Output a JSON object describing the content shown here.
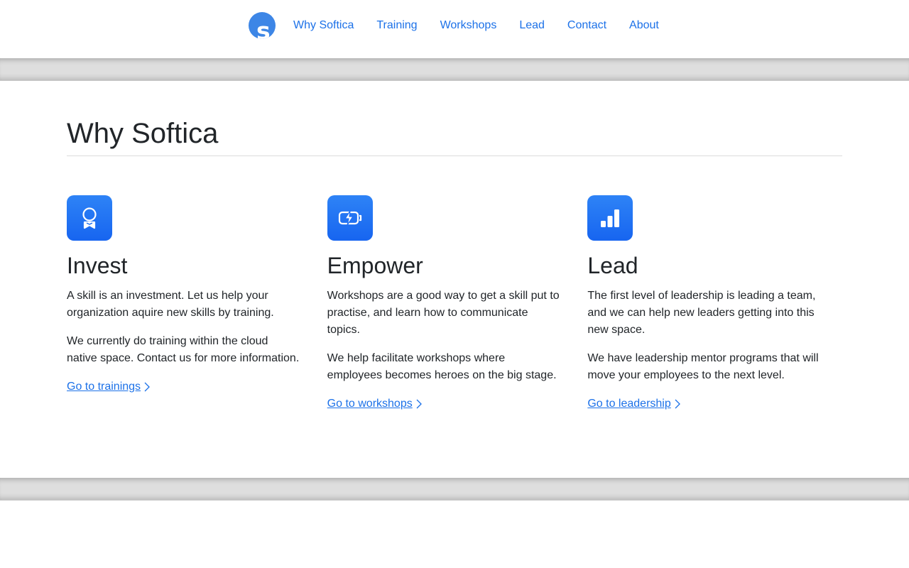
{
  "nav": {
    "logo_letter": "s",
    "links": [
      "Why Softica",
      "Training",
      "Workshops",
      "Lead",
      "Contact",
      "About"
    ]
  },
  "main": {
    "title": "Why Softica",
    "columns": [
      {
        "icon": "award-icon",
        "title": "Invest",
        "paragraphs": [
          "A skill is an investment. Let us help your organization aquire new skills by training.",
          "We currently do training within the cloud native space. Contact us for more information."
        ],
        "link": "Go to trainings"
      },
      {
        "icon": "battery-charging-icon",
        "title": "Empower",
        "paragraphs": [
          "Workshops are a good way to get a skill put to practise, and learn how to communicate topics.",
          "We help facilitate workshops where employees becomes heroes on the big stage."
        ],
        "link": "Go to workshops"
      },
      {
        "icon": "bar-chart-icon",
        "title": "Lead",
        "paragraphs": [
          "The first level of leadership is leading a team, and we can help new leaders getting into this new space.",
          "We have leadership mentor programs that will move your employees to the next level."
        ],
        "link": "Go to leadership"
      }
    ]
  },
  "colors": {
    "accent": "#1c71e8",
    "icon_bg": "#1f6ff2",
    "band": "#dedede"
  }
}
